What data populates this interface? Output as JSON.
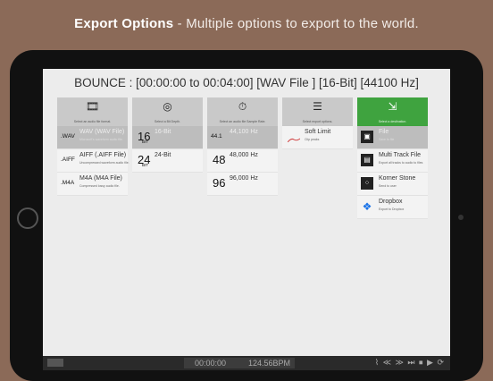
{
  "headline": {
    "bold": "Export Options",
    "rest": " - Multiple options to export to the world."
  },
  "bounce_title": "BOUNCE : [00:00:00 to 00:04:00] [WAV File ] [16-Bit] [44100 Hz]",
  "columns": {
    "format": {
      "icon": "film-icon",
      "subtitle": "Select an audio file format.",
      "rows": [
        {
          "badge": ".WAV",
          "label": "WAV (WAV File)",
          "desc": "Microsoft's waveform audio file."
        },
        {
          "badge": ".AIFF",
          "label": "AIFF (.AIFF File)",
          "desc": "Uncompressed waveform audio file."
        },
        {
          "badge": ".M4A",
          "label": "M4A (M4A File)",
          "desc": "Compressed lossy audio file."
        }
      ]
    },
    "bits": {
      "icon": "disc-icon",
      "subtitle": "Select a Bit Depth.",
      "rows": [
        {
          "big": "16",
          "small": "BIT",
          "label": "16-Bit"
        },
        {
          "big": "24",
          "small": "BIT",
          "label": "24-Bit"
        }
      ]
    },
    "rate": {
      "icon": "stopwatch-icon",
      "subtitle": "Select an audio file Sample Rate.",
      "rows": [
        {
          "badge": "44.1",
          "label": "44,100 Hz"
        },
        {
          "big": "48",
          "label": "48,000 Hz"
        },
        {
          "big": "96",
          "label": "96,000 Hz"
        }
      ]
    },
    "options": {
      "icon": "list-icon",
      "subtitle": "Select export options.",
      "rows": [
        {
          "label": "Soft Limit",
          "desc": "Clip peaks"
        }
      ]
    },
    "destination": {
      "icon": "export-icon",
      "subtitle": "Select a destination.",
      "rows": [
        {
          "label": "File",
          "desc": "Save to file"
        },
        {
          "label": "Multi Track File",
          "desc": "Export all tracks to audio to files"
        },
        {
          "label": "Korner Stone",
          "desc": "Send to user"
        },
        {
          "label": "Dropbox",
          "desc": "Export to Dropbox"
        }
      ]
    }
  },
  "toolbar": {
    "time": "00:00:00",
    "bpm": "124.56BPM",
    "controls": "⌇ ≪ ≫ ⏭ ⏹ ▶ ⟳"
  },
  "colors": {
    "accent": "#3fa33f",
    "background": "#8b6a58"
  }
}
